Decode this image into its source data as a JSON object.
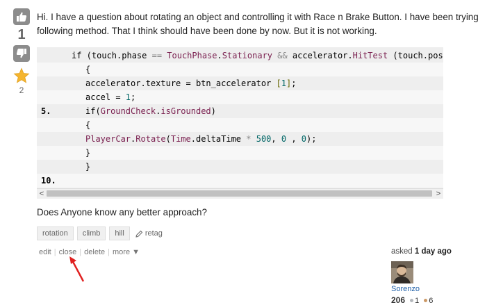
{
  "vote": {
    "count": "1",
    "favorite_count": "2"
  },
  "question": {
    "line1": "Hi. I have a question about rotating an object and controlling it with Race n Brake Button. I have been trying to",
    "line2": "following method. That I think should have been done by now. But it is not working."
  },
  "code": {
    "line_numbers": [
      "",
      "",
      "",
      "",
      "5.",
      "",
      "",
      "",
      "",
      "10."
    ],
    "lines": [
      "if (touch.phase == TouchPhase.Stationary && accelerator.HitTest (touch.positi",
      "{",
      "accelerator.texture = btn_accelerator [1];",
      "accel = 1;",
      "if(GroundCheck.isGrounded)",
      "{",
      "PlayerCar.Rotate(Time.deltaTime * 500, 0 , 0);",
      "}",
      "}",
      ""
    ],
    "scroll_left": "<",
    "scroll_right": ">"
  },
  "followup": "Does Anyone know any better approach?",
  "tags": [
    "rotation",
    "climb",
    "hill"
  ],
  "retag_label": "retag",
  "actions": {
    "edit": "edit",
    "close": "close",
    "delete": "delete",
    "more": "more ▼"
  },
  "owner": {
    "asked_label": "asked",
    "asked_when": "1 day ago",
    "username": "Sorenzo",
    "reputation": "206",
    "silver": "1",
    "bronze": "6"
  },
  "colors": {
    "silver": "#b4b8bc",
    "bronze": "#cc9966",
    "star": "#f5b52e",
    "link": "#1e5fa8",
    "annotation_arrow": "#e02020"
  }
}
